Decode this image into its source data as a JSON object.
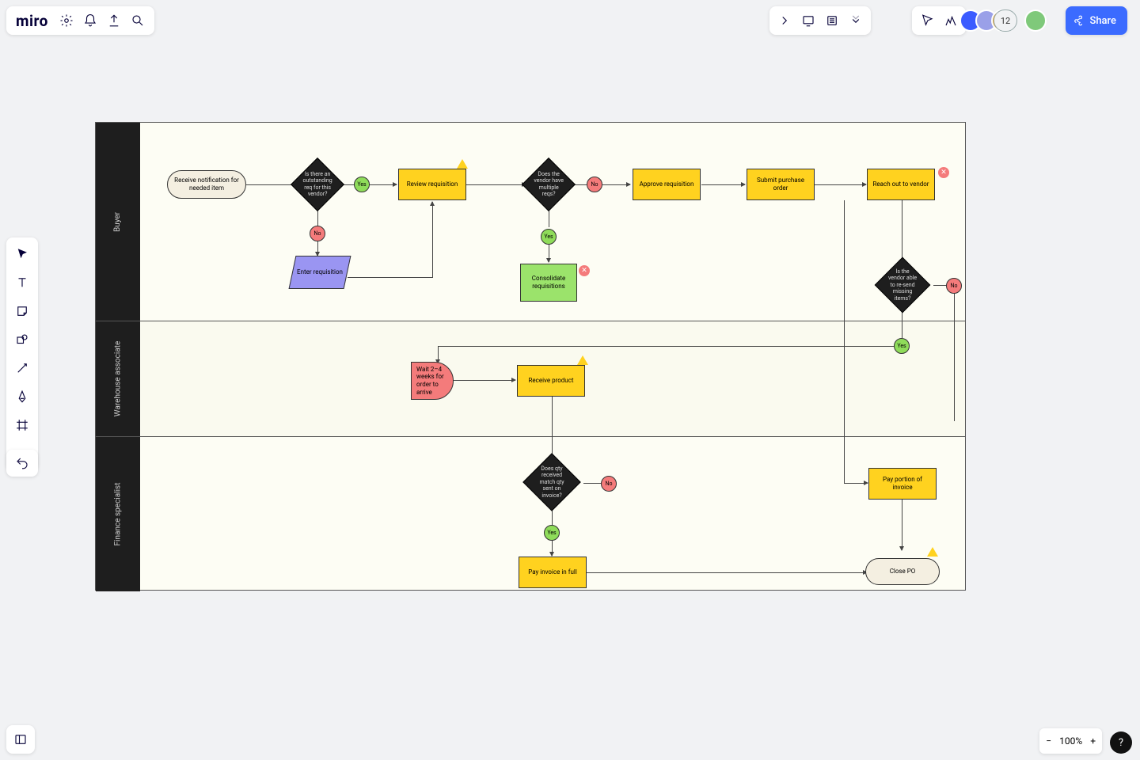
{
  "header": {
    "logo": "miro",
    "share": "Share",
    "avatar_overflow": "12"
  },
  "zoom": {
    "level": "100%",
    "help": "?"
  },
  "lanes": {
    "buyer": "Buyer",
    "warehouse": "Warehouse associate",
    "finance": "Finance specialist"
  },
  "nodes": {
    "n1": "Receive notification for needed item",
    "n2": "Is there an outstanding req for this vendor?",
    "n3": "Review requisition",
    "n4": "Does the vendor have multiple reqs?",
    "n5": "Approve requisition",
    "n6": "Submit purchase order",
    "n7": "Reach out to vendor",
    "n8": "Enter requisition",
    "n9": "Consolidate requisitions",
    "n10": "Is the vendor able to re-send missing items?",
    "n11": "Wait 2–4 weeks for order to arrive",
    "n12": "Receive product",
    "n13": "Does qty received match qty sent on invoice?",
    "n14": "Pay portion of invoice",
    "n15": "Pay invoice in full",
    "n16": "Close PO"
  },
  "labels": {
    "yes": "Yes",
    "no": "No"
  },
  "badges": {
    "cross": "✕"
  }
}
